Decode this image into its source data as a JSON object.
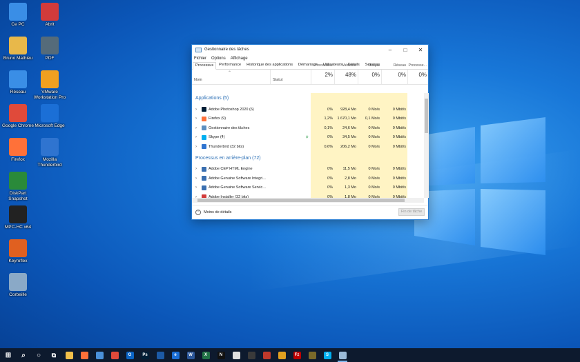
{
  "desktop": {
    "icons": [
      {
        "label": "Ce PC",
        "icon": "computer-icon",
        "color": "#3a8ee6"
      },
      {
        "label": "Abrit",
        "icon": "save-icon",
        "color": "#d23b3b"
      },
      {
        "label": "Bruno Mathieu",
        "icon": "user-folder-icon",
        "color": "#e8b84a"
      },
      {
        "label": "PDF",
        "icon": "app-icon",
        "color": "#556b7a"
      },
      {
        "label": "Réseau",
        "icon": "network-icon",
        "color": "#3a8ee6"
      },
      {
        "label": "VMware Workstation Pro",
        "icon": "vmware-icon",
        "color": "#f0a020"
      },
      {
        "label": "Google Chrome",
        "icon": "chrome-icon",
        "color": "#e04a3a"
      },
      {
        "label": "Microsoft Edge",
        "icon": "edge-icon",
        "color": "#1b6fd6"
      },
      {
        "label": "Firefox",
        "icon": "firefox-icon",
        "color": "#ff7139"
      },
      {
        "label": "Mozilla Thunderbird",
        "icon": "thunderbird-icon",
        "color": "#2f74d0"
      },
      {
        "label": "DiskPart Snapshot",
        "icon": "app-icon",
        "color": "#2a8a3a"
      },
      {
        "label": "MPC-HC x64",
        "icon": "video-player-icon",
        "color": "#222222"
      },
      {
        "label": "Keyroflex",
        "icon": "java-icon",
        "color": "#e06020"
      },
      {
        "label": "Corbeille",
        "icon": "recycle-bin-icon",
        "color": "#8aa9c7"
      }
    ]
  },
  "window": {
    "title": "Gestionnaire des tâches",
    "menu": [
      "Fichier",
      "Options",
      "Affichage"
    ],
    "tabs": [
      "Processus",
      "Performance",
      "Historique des applications",
      "Démarrage",
      "Utilisateurs",
      "Détails",
      "Services"
    ],
    "active_tab": "Processus",
    "columns": {
      "name": "Nom",
      "status": "Statut",
      "metrics": [
        {
          "pct": "2%",
          "label": "Processeur"
        },
        {
          "pct": "48%",
          "label": "Mémoire"
        },
        {
          "pct": "0%",
          "label": "Disque"
        },
        {
          "pct": "0%",
          "label": "Réseau"
        },
        {
          "pct": "0%",
          "label": "Processe..."
        }
      ]
    },
    "sections": [
      {
        "title": "Applications (5)",
        "rows": [
          {
            "name": "Adobe Photoshop 2020 (6)",
            "cpu": "0%",
            "mem": "928,4 Mo",
            "disk": "0 Mo/s",
            "net": "0 Mbit/s",
            "icon_color": "#001e36"
          },
          {
            "name": "Firefox (9)",
            "cpu": "1,2%",
            "mem": "1 670,1 Mo",
            "disk": "0,1 Mo/s",
            "net": "0 Mbit/s",
            "icon_color": "#ff7139"
          },
          {
            "name": "Gestionnaire des tâches",
            "cpu": "0,1%",
            "mem": "24,6 Mo",
            "disk": "0 Mo/s",
            "net": "0 Mbit/s",
            "icon_color": "#5c8fbf"
          },
          {
            "name": "Skype (4)",
            "cpu": "0%",
            "mem": "34,5 Mo",
            "disk": "0 Mo/s",
            "net": "0 Mbit/s",
            "icon_color": "#00aff0"
          },
          {
            "name": "Thunderbird (32 bits)",
            "cpu": "0,6%",
            "mem": "206,2 Mo",
            "disk": "0 Mo/s",
            "net": "0 Mbit/s",
            "icon_color": "#2f74d0"
          }
        ]
      },
      {
        "title": "Processus en arrière-plan (72)",
        "rows": [
          {
            "name": "Adobe CEP HTML Engine",
            "cpu": "0%",
            "mem": "11,5 Mo",
            "disk": "0 Mo/s",
            "net": "0 Mbit/s",
            "icon_color": "#3a6fb0"
          },
          {
            "name": "Adobe Genuine Software Integri...",
            "cpu": "0%",
            "mem": "2,8 Mo",
            "disk": "0 Mo/s",
            "net": "0 Mbit/s",
            "icon_color": "#3a6fb0"
          },
          {
            "name": "Adobe Genuine Software Servic...",
            "cpu": "0%",
            "mem": "1,3 Mo",
            "disk": "0 Mo/s",
            "net": "0 Mbit/s",
            "icon_color": "#3a6fb0"
          },
          {
            "name": "Adobe Installer (32 bits)",
            "cpu": "0%",
            "mem": "1,8 Mo",
            "disk": "0 Mo/s",
            "net": "0 Mbit/s",
            "icon_color": "#d23b3b"
          }
        ]
      }
    ],
    "footer": {
      "less_details": "Moins de détails",
      "end_task": "Fin de tâche"
    }
  },
  "taskbar": {
    "items": [
      {
        "icon": "windows-start-icon",
        "color": "#ffffff",
        "glyph": ""
      },
      {
        "icon": "search-icon",
        "color": "#ffffff",
        "glyph": ""
      },
      {
        "icon": "cortana-icon",
        "color": "#ffffff",
        "glyph": ""
      },
      {
        "icon": "task-view-icon",
        "color": "#ffffff",
        "glyph": ""
      },
      {
        "icon": "file-explorer-icon",
        "color": "#f2c04a",
        "glyph": ""
      },
      {
        "icon": "firefox-icon",
        "color": "#ff7139",
        "glyph": ""
      },
      {
        "icon": "app-icon",
        "color": "#4a90d9",
        "glyph": ""
      },
      {
        "icon": "chrome-icon",
        "color": "#e04a3a",
        "glyph": ""
      },
      {
        "icon": "outlook-icon",
        "color": "#0a64c6",
        "glyph": "O"
      },
      {
        "icon": "photoshop-icon",
        "color": "#001e36",
        "glyph": "Ps"
      },
      {
        "icon": "app-icon",
        "color": "#1c5aa6",
        "glyph": ""
      },
      {
        "icon": "edge-icon",
        "color": "#1b6fd6",
        "glyph": "e"
      },
      {
        "icon": "word-icon",
        "color": "#2b579a",
        "glyph": "W"
      },
      {
        "icon": "excel-icon",
        "color": "#217346",
        "glyph": "X"
      },
      {
        "icon": "netflix-icon",
        "color": "#111111",
        "glyph": "N"
      },
      {
        "icon": "app-icon",
        "color": "#e0e0e0",
        "glyph": ""
      },
      {
        "icon": "app-icon",
        "color": "#3a3a3a",
        "glyph": ""
      },
      {
        "icon": "app-icon",
        "color": "#c0392b",
        "glyph": ""
      },
      {
        "icon": "app-icon",
        "color": "#e0a020",
        "glyph": ""
      },
      {
        "icon": "filezilla-icon",
        "color": "#bf0000",
        "glyph": "Fz"
      },
      {
        "icon": "app-icon",
        "color": "#7a6a2a",
        "glyph": ""
      },
      {
        "icon": "skype-icon",
        "color": "#00aff0",
        "glyph": "S"
      },
      {
        "icon": "task-manager-icon",
        "color": "#9bbbd8",
        "glyph": ""
      }
    ]
  }
}
